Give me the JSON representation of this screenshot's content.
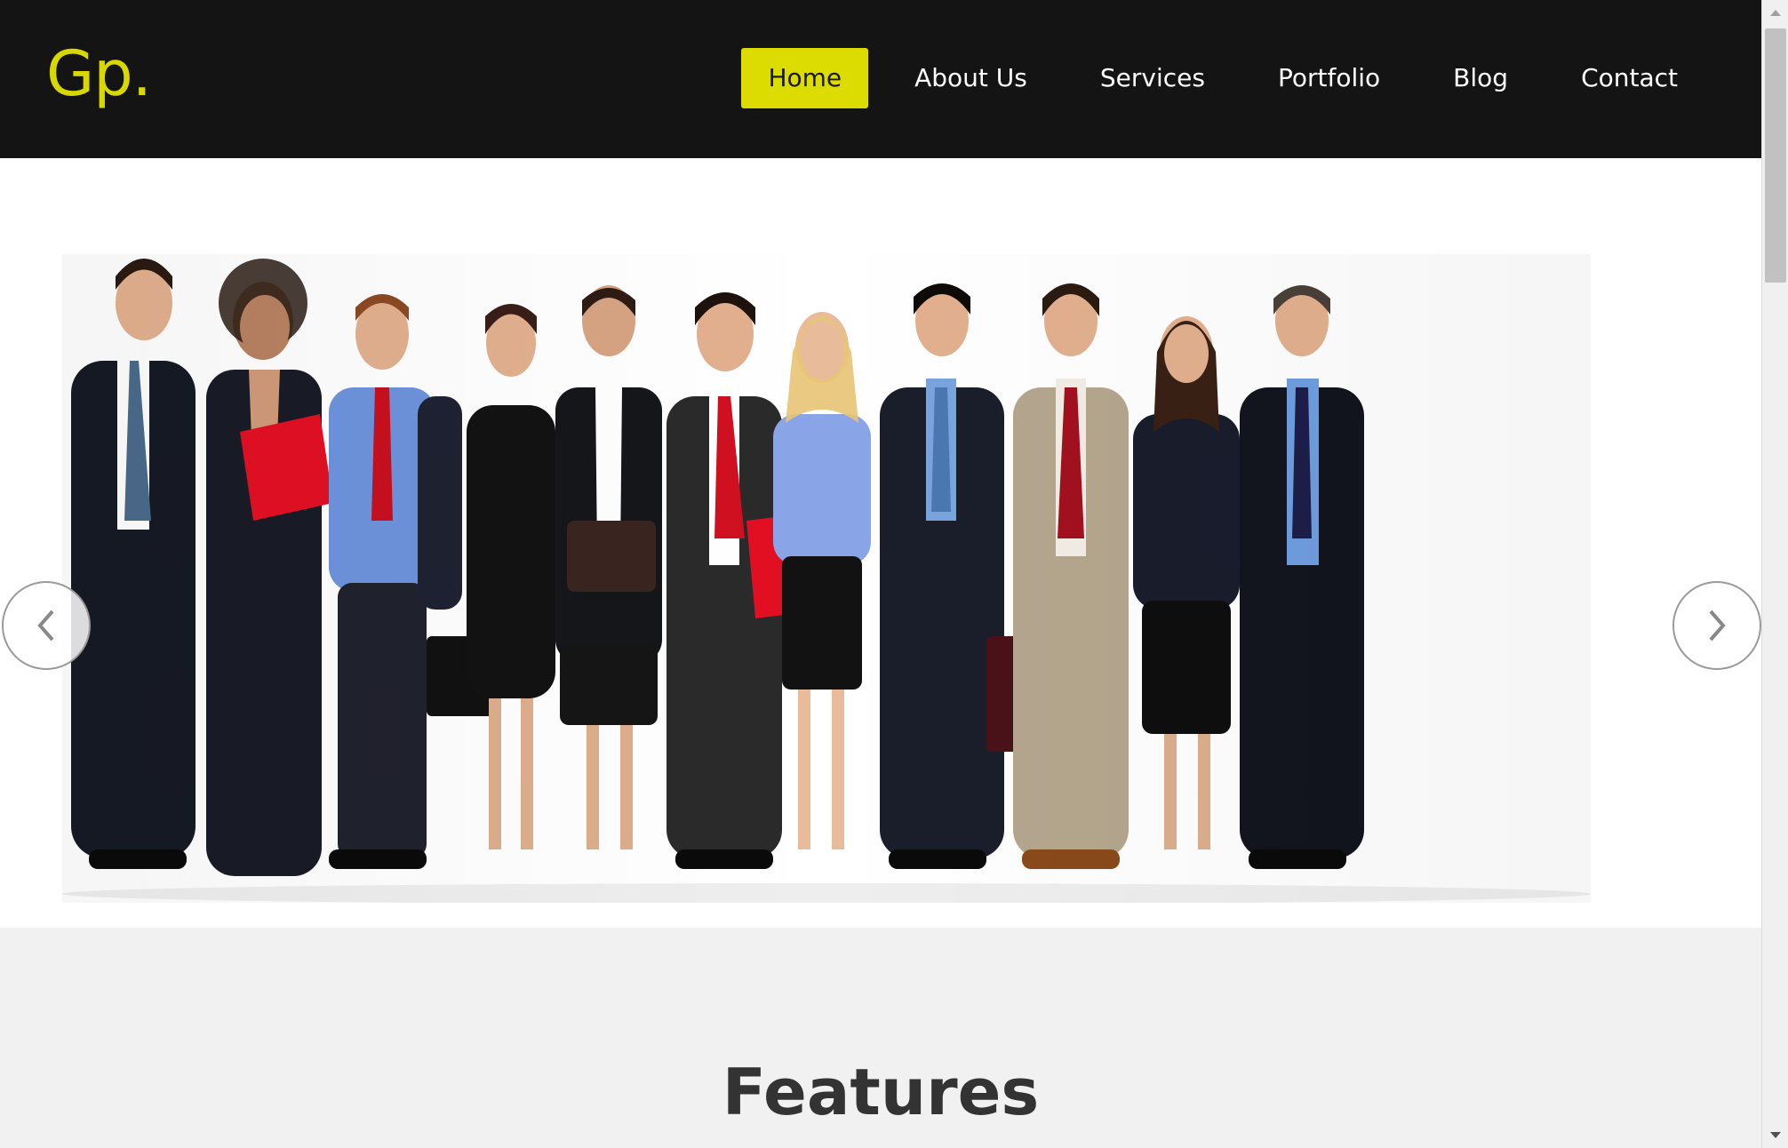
{
  "brand": {
    "logo_text": "Gp.",
    "accent_color": "#dcdc00"
  },
  "nav": {
    "items": [
      {
        "label": "Home",
        "active": true
      },
      {
        "label": "About Us",
        "active": false
      },
      {
        "label": "Services",
        "active": false
      },
      {
        "label": "Portfolio",
        "active": false
      },
      {
        "label": "Blog",
        "active": false
      },
      {
        "label": "Contact",
        "active": false
      }
    ]
  },
  "hero": {
    "image": "group-of-business-people-photo",
    "prev_icon": "chevron-left-icon",
    "next_icon": "chevron-right-icon"
  },
  "features": {
    "title": "Features"
  },
  "colors": {
    "navbar_bg": "#141414",
    "nav_text": "#ffffff",
    "section_bg": "#f1f1f1",
    "heading": "#333333"
  }
}
